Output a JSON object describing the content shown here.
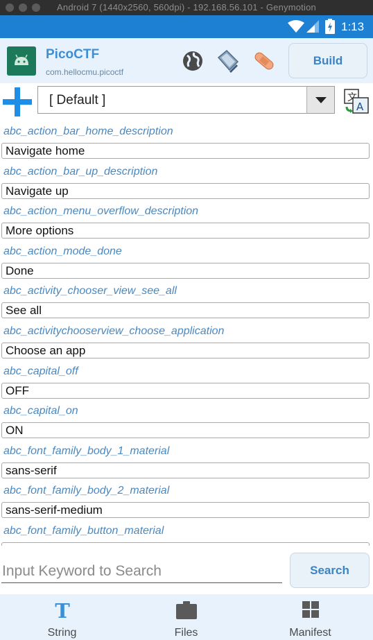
{
  "window": {
    "title": "Android 7 (1440x2560, 560dpi) - 192.168.56.101 - Genymotion"
  },
  "status_bar": {
    "time": "1:13"
  },
  "app": {
    "name": "PicoCTF",
    "package": "com.hellocmu.picoctf",
    "build_label": "Build"
  },
  "language": {
    "selected": "[ Default ]"
  },
  "strings": [
    {
      "key": "abc_action_bar_home_description",
      "value": "Navigate home"
    },
    {
      "key": "abc_action_bar_up_description",
      "value": "Navigate up"
    },
    {
      "key": "abc_action_menu_overflow_description",
      "value": "More options"
    },
    {
      "key": "abc_action_mode_done",
      "value": "Done"
    },
    {
      "key": "abc_activity_chooser_view_see_all",
      "value": "See all"
    },
    {
      "key": "abc_activitychooserview_choose_application",
      "value": "Choose an app"
    },
    {
      "key": "abc_capital_off",
      "value": "OFF"
    },
    {
      "key": "abc_capital_on",
      "value": "ON"
    },
    {
      "key": "abc_font_family_body_1_material",
      "value": "sans-serif"
    },
    {
      "key": "abc_font_family_body_2_material",
      "value": "sans-serif-medium"
    },
    {
      "key": "abc_font_family_button_material",
      "value": ""
    }
  ],
  "search": {
    "placeholder": "Input Keyword to Search",
    "value": "",
    "button_label": "Search"
  },
  "bottom_nav": {
    "items": [
      {
        "label": "String",
        "icon": "text-t-icon",
        "active": true
      },
      {
        "label": "Files",
        "icon": "folder-icon",
        "active": false
      },
      {
        "label": "Manifest",
        "icon": "grid-icon",
        "active": false
      }
    ]
  },
  "colors": {
    "status_bar": "#1e80d2",
    "header_bg": "#e8f2fc",
    "accent": "#3a8fd6",
    "key_text": "#4a88c0"
  }
}
